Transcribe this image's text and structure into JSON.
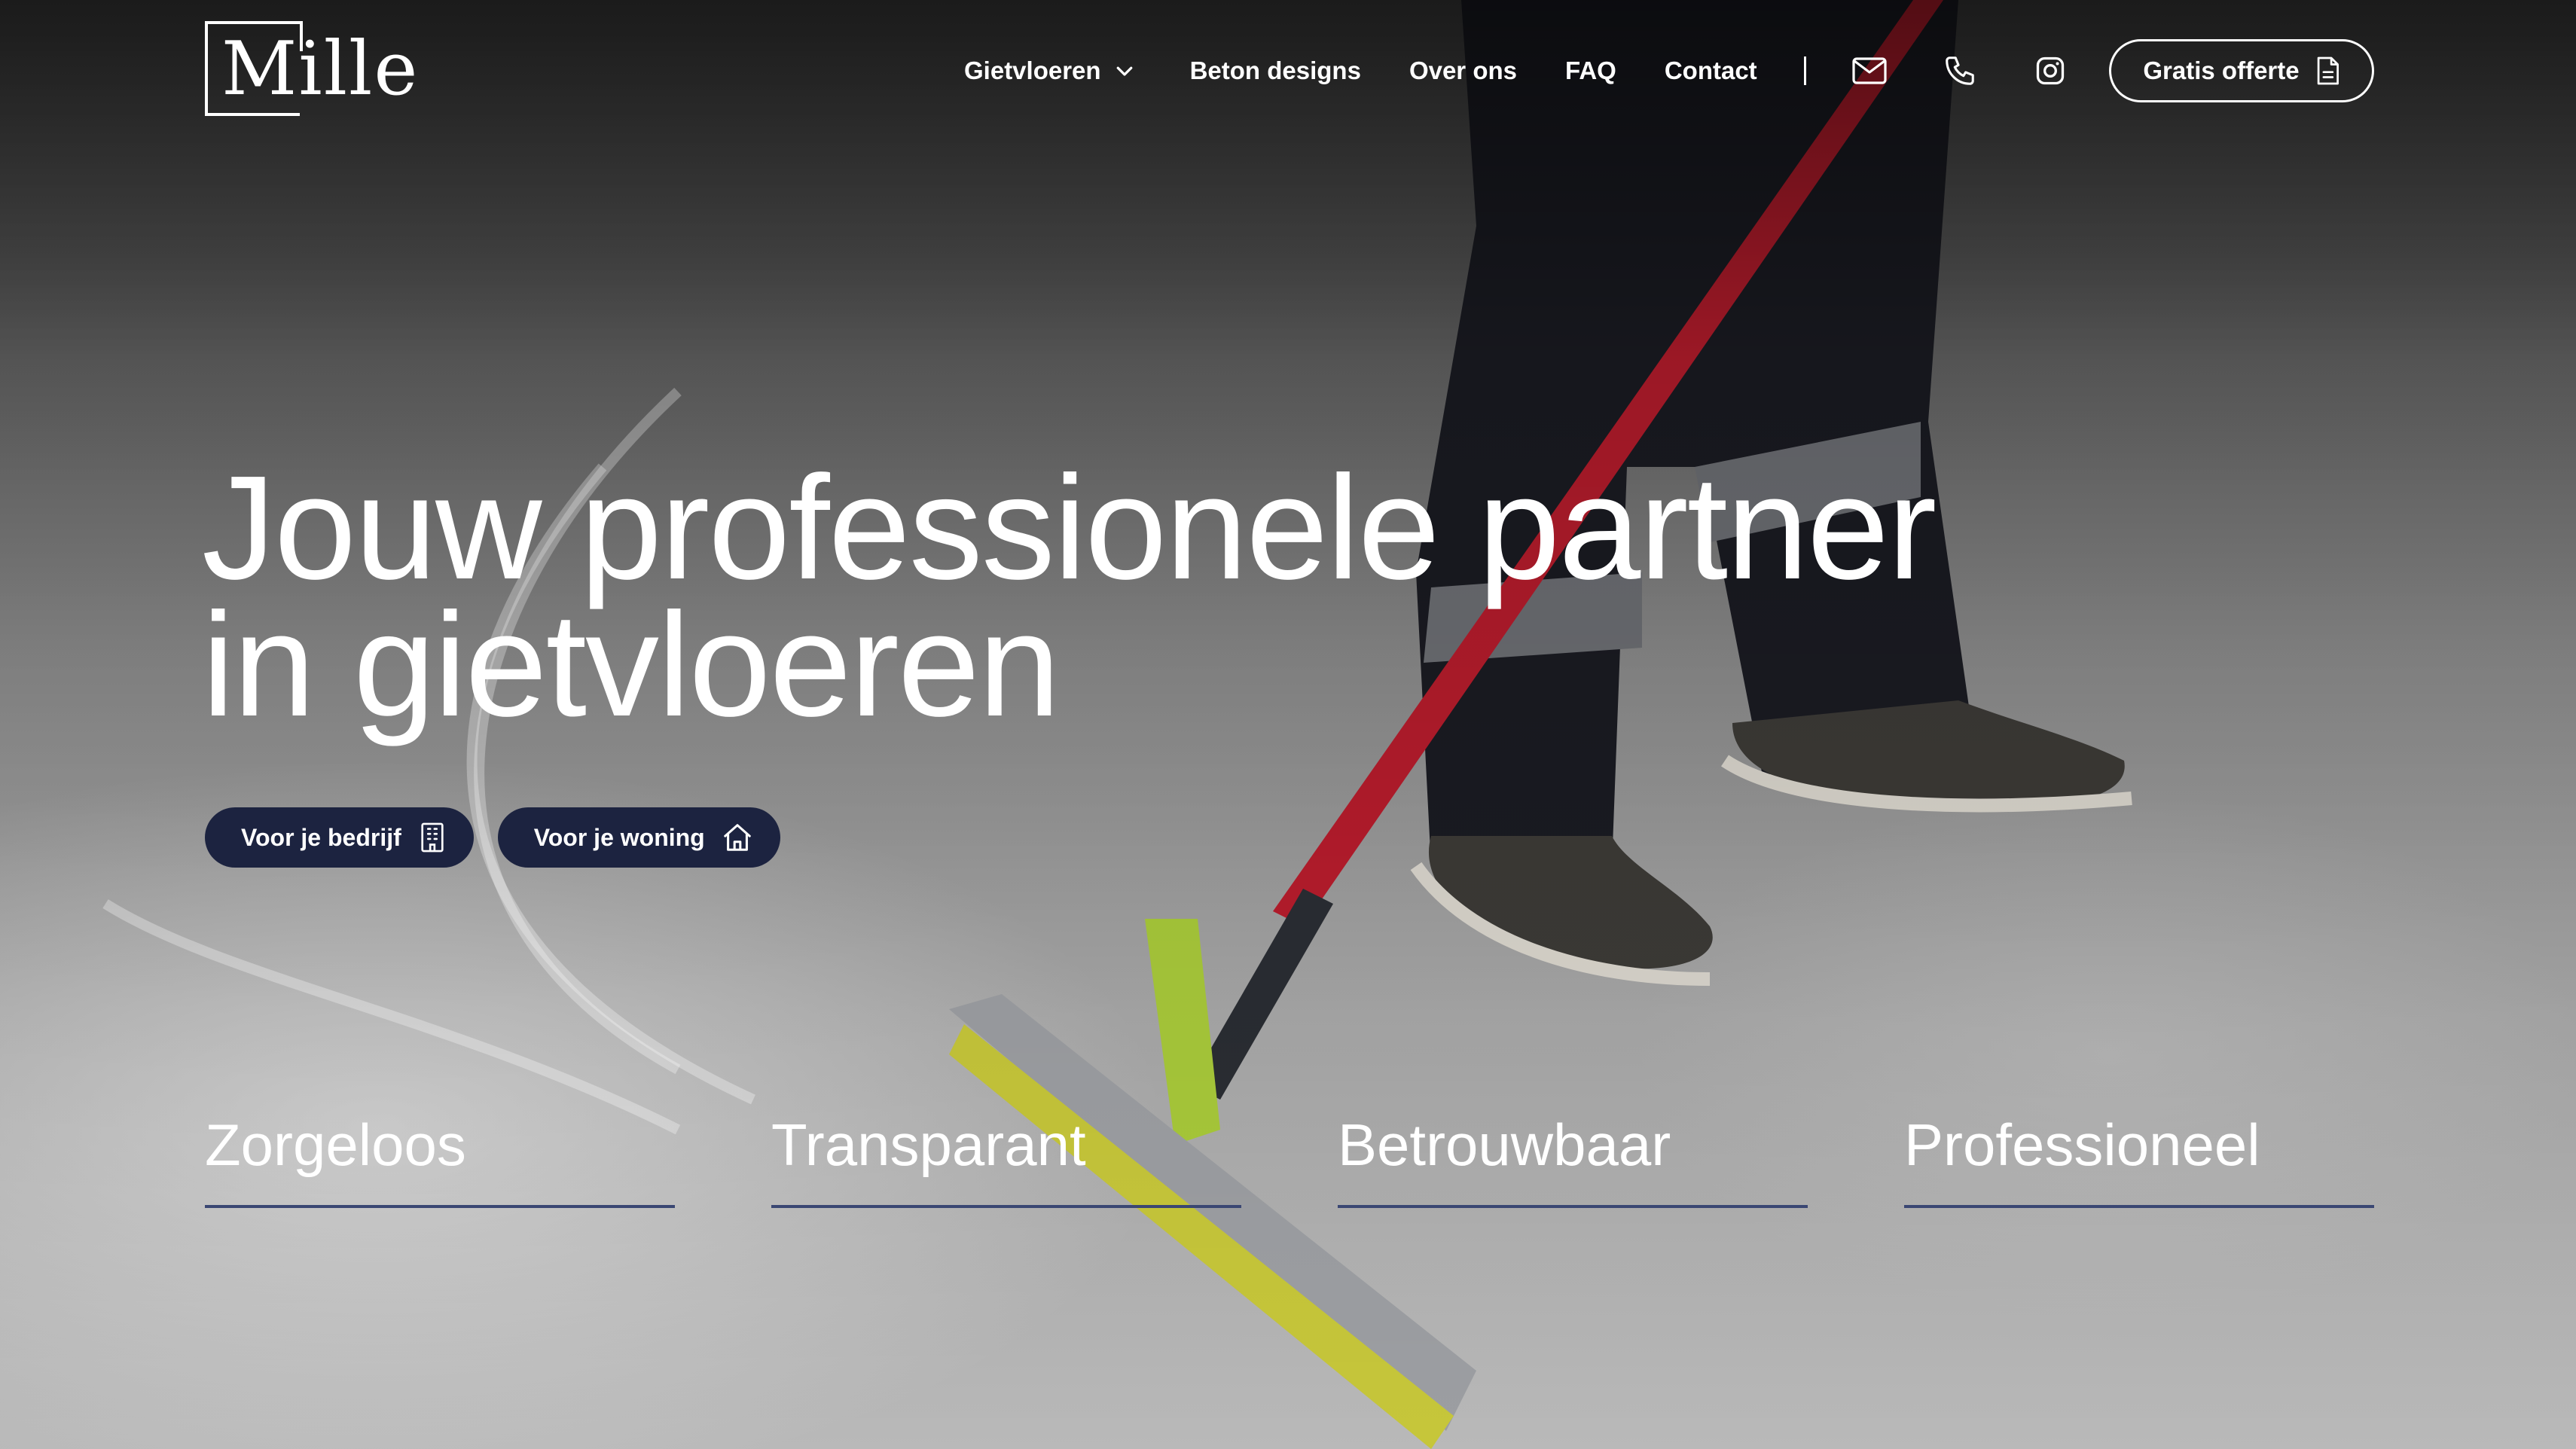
{
  "brand": {
    "logo_text": "Mille"
  },
  "nav": {
    "items": [
      {
        "label": "Gietvloeren",
        "has_dropdown": true
      },
      {
        "label": "Beton designs"
      },
      {
        "label": "Over ons"
      },
      {
        "label": "FAQ"
      },
      {
        "label": "Contact"
      }
    ],
    "icons": [
      "mail-icon",
      "phone-icon",
      "instagram-icon"
    ],
    "cta_label": "Gratis offerte",
    "cta_icon": "document-icon"
  },
  "hero": {
    "title_line1": "Jouw professionele partner",
    "title_line2": "in gietvloeren",
    "buttons": [
      {
        "label": "Voor je bedrijf",
        "icon": "building-icon"
      },
      {
        "label": "Voor je woning",
        "icon": "house-icon"
      }
    ]
  },
  "values": [
    {
      "label": "Zorgeloos"
    },
    {
      "label": "Transparant"
    },
    {
      "label": "Betrouwbaar"
    },
    {
      "label": "Professioneel"
    }
  ],
  "colors": {
    "button_bg": "#1c2340",
    "underline": "#3a4773",
    "text": "#ffffff"
  }
}
